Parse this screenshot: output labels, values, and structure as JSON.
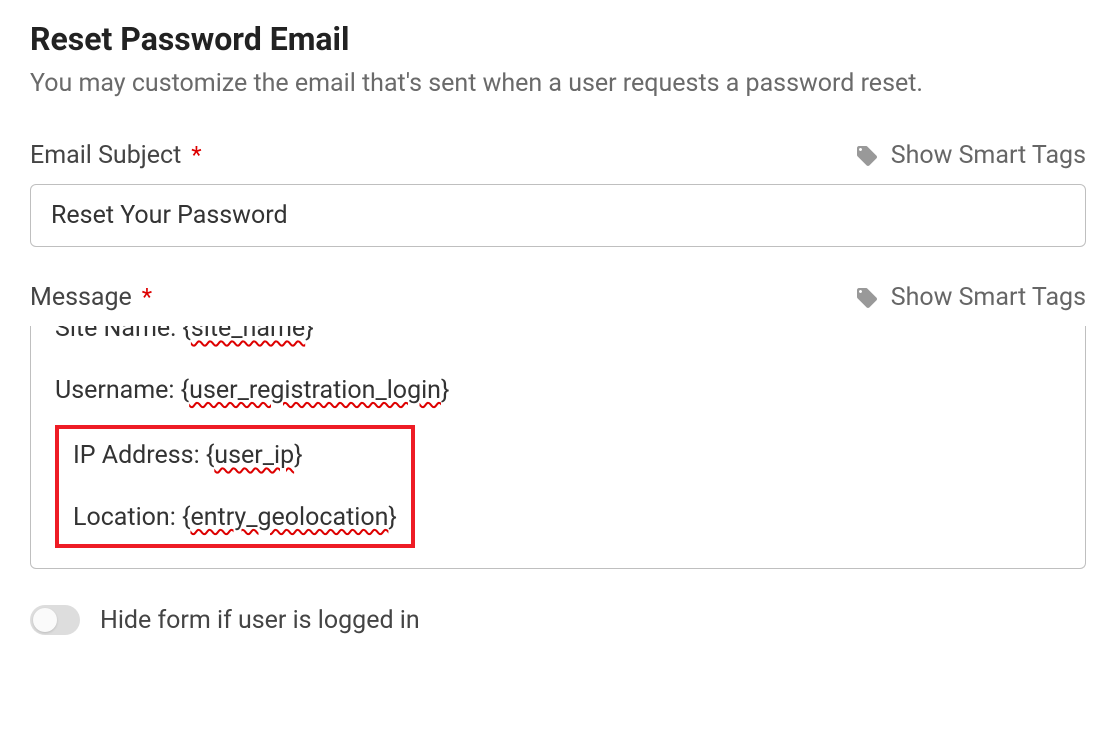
{
  "section": {
    "title": "Reset Password Email",
    "description": "You may customize the email that's sent when a user requests a password reset."
  },
  "subject": {
    "label": "Email Subject",
    "required": "*",
    "smartTagsLabel": "Show Smart Tags",
    "value": "Reset Your Password"
  },
  "message": {
    "label": "Message",
    "required": "*",
    "smartTagsLabel": "Show Smart Tags",
    "cutoff": {
      "prefix": "Site Name: {",
      "tag": "site_name",
      "suffix": "}"
    },
    "line1": {
      "prefix": "Username: {",
      "tag": "user_registration_login",
      "suffix": "}"
    },
    "highlight": {
      "lineA": {
        "prefix": "IP Address: {",
        "tag": "user_ip",
        "suffix": "}"
      },
      "lineB": {
        "prefix": "Location: {",
        "tag": "entry_geolocation",
        "suffix": "}"
      }
    }
  },
  "toggle": {
    "label": "Hide form if user is logged in",
    "checked": false
  }
}
